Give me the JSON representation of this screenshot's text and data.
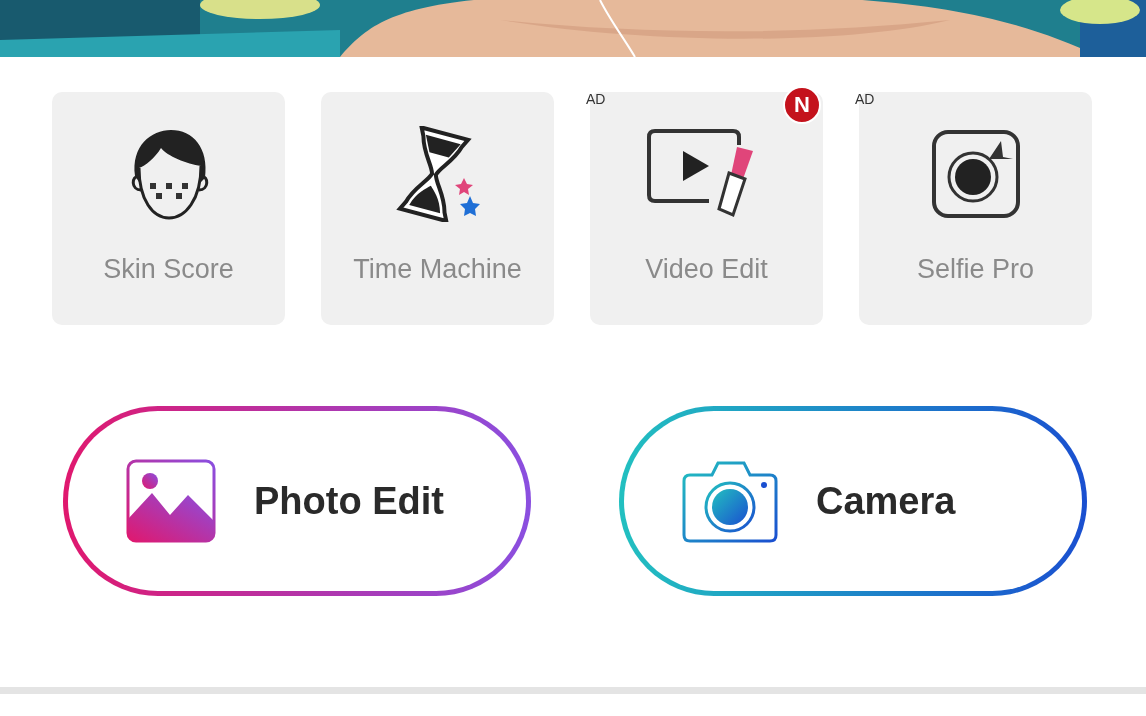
{
  "tools": [
    {
      "label": "Skin Score"
    },
    {
      "label": "Time Machine"
    },
    {
      "label": "Video Edit",
      "ad_tag": "AD",
      "badge": "N"
    },
    {
      "label": "Selfie Pro",
      "ad_tag": "AD"
    }
  ],
  "actions": [
    {
      "label": "Photo Edit"
    },
    {
      "kind": "camera",
      "label": "Camera"
    }
  ]
}
